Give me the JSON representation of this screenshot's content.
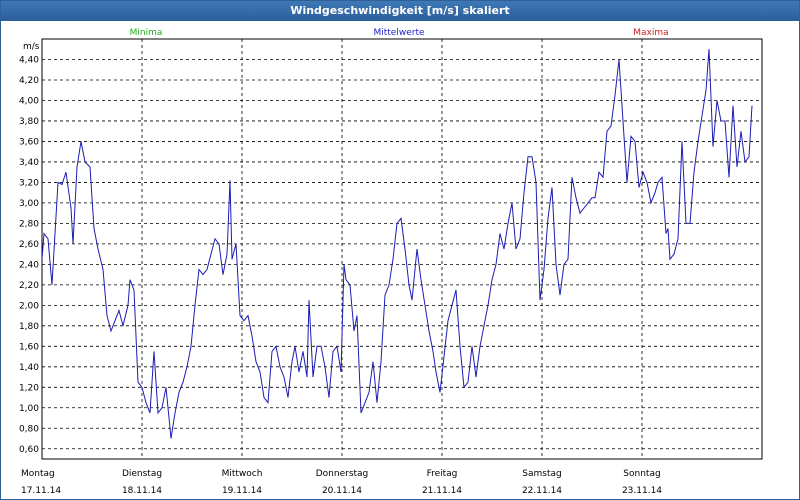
{
  "window": {
    "title": "Windgeschwindigkeit [m/s] skaliert"
  },
  "legend": [
    {
      "label": "Minima",
      "color": "#22aa22"
    },
    {
      "label": "Mittelwerte",
      "color": "#2222cc"
    },
    {
      "label": "Maxima",
      "color": "#cc2222"
    }
  ],
  "chart_data": {
    "type": "line",
    "title": "Windgeschwindigkeit [m/s] skaliert",
    "ylabel": "m/s",
    "ylim": [
      0.5,
      4.6
    ],
    "xlim": [
      0,
      7.2
    ],
    "grid": true,
    "y_ticks": [
      "0,60",
      "0,80",
      "1,00",
      "1,20",
      "1,40",
      "1,60",
      "1,80",
      "2,00",
      "2,20",
      "2,40",
      "2,60",
      "2,80",
      "3,00",
      "3,20",
      "3,40",
      "3,60",
      "3,80",
      "4,00",
      "4,20",
      "4,40"
    ],
    "x_ticks": [
      {
        "day": "Montag",
        "date": "17.11.14",
        "x": 0
      },
      {
        "day": "Dienstag",
        "date": "18.11.14",
        "x": 1
      },
      {
        "day": "Mittwoch",
        "date": "19.11.14",
        "x": 2
      },
      {
        "day": "Donnerstag",
        "date": "20.11.14",
        "x": 3
      },
      {
        "day": "Freitag",
        "date": "21.11.14",
        "x": 4
      },
      {
        "day": "Samstag",
        "date": "22.11.14",
        "x": 5
      },
      {
        "day": "Sonntag",
        "date": "23.11.14",
        "x": 6
      }
    ],
    "series": [
      {
        "name": "Mittelwerte",
        "color": "#1c1cb4",
        "points": [
          [
            0.0,
            2.45
          ],
          [
            0.02,
            2.7
          ],
          [
            0.06,
            2.65
          ],
          [
            0.1,
            2.2
          ],
          [
            0.16,
            3.2
          ],
          [
            0.2,
            3.18
          ],
          [
            0.24,
            3.3
          ],
          [
            0.29,
            2.95
          ],
          [
            0.31,
            2.6
          ],
          [
            0.35,
            3.35
          ],
          [
            0.39,
            3.6
          ],
          [
            0.43,
            3.4
          ],
          [
            0.48,
            3.35
          ],
          [
            0.52,
            2.75
          ],
          [
            0.56,
            2.55
          ],
          [
            0.61,
            2.35
          ],
          [
            0.65,
            1.9
          ],
          [
            0.69,
            1.75
          ],
          [
            0.73,
            1.85
          ],
          [
            0.77,
            1.95
          ],
          [
            0.81,
            1.8
          ],
          [
            0.86,
            2.0
          ],
          [
            0.88,
            2.25
          ],
          [
            0.92,
            2.15
          ],
          [
            0.96,
            1.25
          ],
          [
            1.0,
            1.2
          ],
          [
            1.04,
            1.05
          ],
          [
            1.08,
            0.95
          ],
          [
            1.12,
            1.55
          ],
          [
            1.16,
            0.95
          ],
          [
            1.2,
            1.0
          ],
          [
            1.24,
            1.2
          ],
          [
            1.29,
            0.7
          ],
          [
            1.33,
            0.95
          ],
          [
            1.37,
            1.15
          ],
          [
            1.41,
            1.25
          ],
          [
            1.45,
            1.4
          ],
          [
            1.49,
            1.6
          ],
          [
            1.53,
            2.0
          ],
          [
            1.57,
            2.35
          ],
          [
            1.61,
            2.3
          ],
          [
            1.65,
            2.35
          ],
          [
            1.69,
            2.5
          ],
          [
            1.73,
            2.65
          ],
          [
            1.77,
            2.6
          ],
          [
            1.81,
            2.3
          ],
          [
            1.85,
            2.5
          ],
          [
            1.88,
            3.22
          ],
          [
            1.9,
            2.45
          ],
          [
            1.94,
            2.6
          ],
          [
            1.98,
            1.9
          ],
          [
            2.02,
            1.85
          ],
          [
            2.06,
            1.9
          ],
          [
            2.1,
            1.7
          ],
          [
            2.14,
            1.45
          ],
          [
            2.18,
            1.35
          ],
          [
            2.22,
            1.1
          ],
          [
            2.26,
            1.05
          ],
          [
            2.3,
            1.55
          ],
          [
            2.34,
            1.6
          ],
          [
            2.38,
            1.4
          ],
          [
            2.42,
            1.3
          ],
          [
            2.46,
            1.1
          ],
          [
            2.5,
            1.45
          ],
          [
            2.53,
            1.6
          ],
          [
            2.57,
            1.35
          ],
          [
            2.61,
            1.55
          ],
          [
            2.65,
            1.3
          ],
          [
            2.67,
            2.05
          ],
          [
            2.71,
            1.3
          ],
          [
            2.75,
            1.6
          ],
          [
            2.79,
            1.6
          ],
          [
            2.83,
            1.4
          ],
          [
            2.87,
            1.1
          ],
          [
            2.91,
            1.55
          ],
          [
            2.95,
            1.6
          ],
          [
            2.99,
            1.35
          ],
          [
            3.02,
            2.4
          ],
          [
            3.04,
            2.25
          ],
          [
            3.08,
            2.2
          ],
          [
            3.12,
            1.75
          ],
          [
            3.15,
            1.9
          ],
          [
            3.19,
            0.95
          ],
          [
            3.23,
            1.05
          ],
          [
            3.27,
            1.15
          ],
          [
            3.31,
            1.45
          ],
          [
            3.35,
            1.05
          ],
          [
            3.39,
            1.45
          ],
          [
            3.43,
            2.1
          ],
          [
            3.47,
            2.2
          ],
          [
            3.51,
            2.45
          ],
          [
            3.55,
            2.8
          ],
          [
            3.59,
            2.85
          ],
          [
            3.63,
            2.55
          ],
          [
            3.67,
            2.2
          ],
          [
            3.7,
            2.05
          ],
          [
            3.75,
            2.55
          ],
          [
            3.79,
            2.25
          ],
          [
            3.83,
            2.0
          ],
          [
            3.87,
            1.75
          ],
          [
            3.91,
            1.55
          ],
          [
            3.94,
            1.35
          ],
          [
            3.98,
            1.15
          ],
          [
            4.02,
            1.5
          ],
          [
            4.06,
            1.85
          ],
          [
            4.1,
            2.0
          ],
          [
            4.14,
            2.15
          ],
          [
            4.18,
            1.6
          ],
          [
            4.22,
            1.2
          ],
          [
            4.26,
            1.25
          ],
          [
            4.3,
            1.6
          ],
          [
            4.34,
            1.3
          ],
          [
            4.38,
            1.6
          ],
          [
            4.42,
            1.8
          ],
          [
            4.46,
            2.0
          ],
          [
            4.5,
            2.25
          ],
          [
            4.54,
            2.4
          ],
          [
            4.58,
            2.7
          ],
          [
            4.62,
            2.55
          ],
          [
            4.66,
            2.8
          ],
          [
            4.7,
            3.0
          ],
          [
            4.74,
            2.55
          ],
          [
            4.78,
            2.65
          ],
          [
            4.82,
            3.1
          ],
          [
            4.86,
            3.45
          ],
          [
            4.9,
            3.45
          ],
          [
            4.94,
            3.2
          ],
          [
            4.98,
            2.05
          ],
          [
            5.02,
            2.35
          ],
          [
            5.06,
            2.85
          ],
          [
            5.1,
            3.15
          ],
          [
            5.14,
            2.4
          ],
          [
            5.18,
            2.1
          ],
          [
            5.22,
            2.4
          ],
          [
            5.26,
            2.45
          ],
          [
            5.3,
            3.25
          ],
          [
            5.34,
            3.05
          ],
          [
            5.38,
            2.9
          ],
          [
            5.42,
            2.95
          ],
          [
            5.46,
            3.0
          ],
          [
            5.5,
            3.05
          ],
          [
            5.53,
            3.05
          ],
          [
            5.57,
            3.3
          ],
          [
            5.61,
            3.25
          ],
          [
            5.65,
            3.7
          ],
          [
            5.69,
            3.75
          ],
          [
            5.73,
            4.05
          ],
          [
            5.77,
            4.4
          ],
          [
            5.81,
            3.8
          ],
          [
            5.85,
            3.2
          ],
          [
            5.89,
            3.65
          ],
          [
            5.93,
            3.6
          ],
          [
            5.97,
            3.15
          ],
          [
            6.01,
            3.3
          ],
          [
            6.05,
            3.2
          ],
          [
            6.09,
            3.0
          ],
          [
            6.13,
            3.1
          ],
          [
            6.16,
            3.2
          ],
          [
            6.2,
            3.25
          ],
          [
            6.24,
            2.7
          ],
          [
            6.26,
            2.75
          ],
          [
            6.28,
            2.45
          ],
          [
            6.32,
            2.5
          ],
          [
            6.36,
            2.65
          ],
          [
            6.4,
            3.6
          ],
          [
            6.44,
            2.8
          ],
          [
            6.48,
            2.8
          ],
          [
            6.52,
            3.3
          ],
          [
            6.56,
            3.6
          ],
          [
            6.6,
            3.85
          ],
          [
            6.64,
            4.1
          ],
          [
            6.67,
            4.5
          ],
          [
            6.71,
            3.55
          ],
          [
            6.75,
            4.0
          ],
          [
            6.79,
            3.8
          ],
          [
            6.83,
            3.8
          ],
          [
            6.87,
            3.25
          ],
          [
            6.91,
            3.95
          ],
          [
            6.95,
            3.35
          ],
          [
            6.99,
            3.7
          ],
          [
            7.03,
            3.4
          ],
          [
            7.07,
            3.45
          ],
          [
            7.1,
            3.95
          ]
        ]
      }
    ]
  }
}
